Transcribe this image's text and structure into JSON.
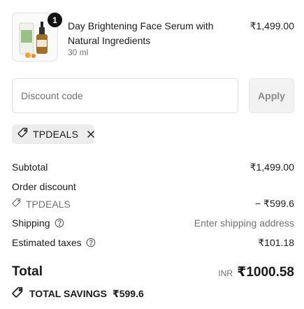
{
  "product": {
    "name": "Day Brightening Face Serum with Natural Ingredients",
    "variant": "30 ml",
    "price": "₹1,499.00",
    "quantity": "1"
  },
  "discount": {
    "placeholder": "Discount code",
    "apply_label": "Apply",
    "applied_code": "TPDEALS"
  },
  "summary": {
    "subtotal_label": "Subtotal",
    "subtotal_value": "₹1,499.00",
    "order_discount_label": "Order discount",
    "discount_code": "TPDEALS",
    "discount_value": "− ₹599.6",
    "shipping_label": "Shipping",
    "shipping_value": "Enter shipping address",
    "taxes_label": "Estimated taxes",
    "taxes_value": "₹101.18"
  },
  "total": {
    "label": "Total",
    "currency": "INR",
    "value": "₹1000.58"
  },
  "savings": {
    "label": "TOTAL SAVINGS",
    "value": "₹599.6"
  },
  "icons": {
    "tag": "tag-icon",
    "close": "close-icon",
    "help": "question-circle-icon",
    "savings": "tag-icon"
  }
}
